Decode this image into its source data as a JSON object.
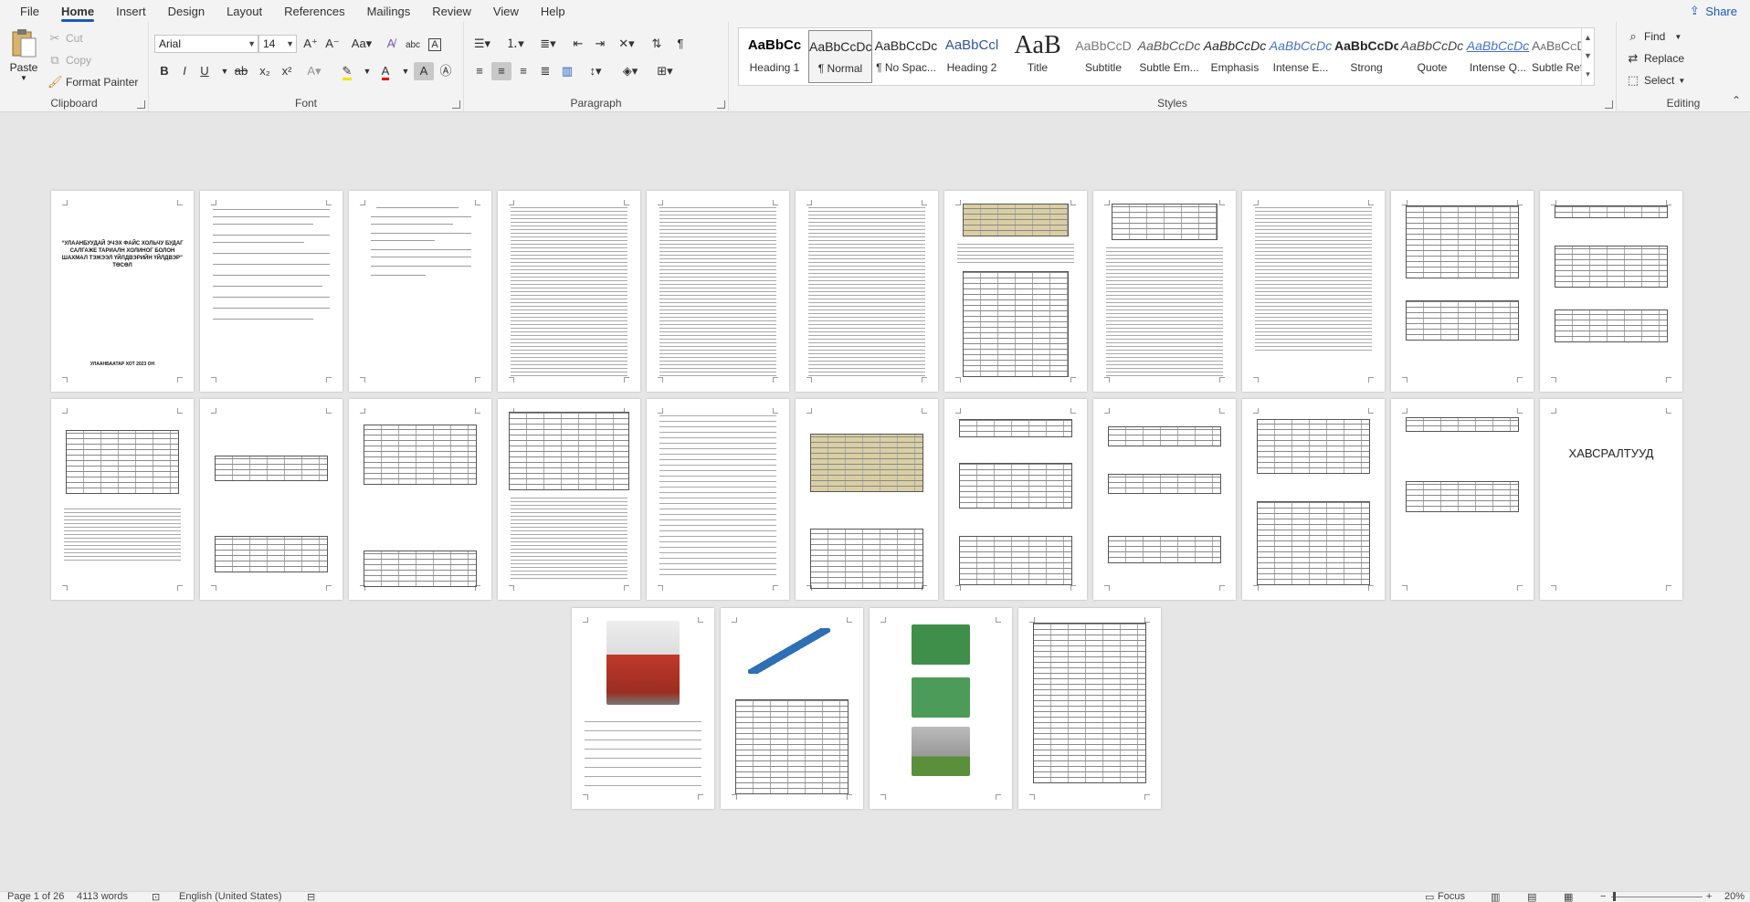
{
  "tabs": [
    "File",
    "Home",
    "Insert",
    "Design",
    "Layout",
    "References",
    "Mailings",
    "Review",
    "View",
    "Help"
  ],
  "active_tab": "Home",
  "share_label": "Share",
  "clipboard": {
    "paste": "Paste",
    "cut": "Cut",
    "copy": "Copy",
    "format_painter": "Format Painter",
    "label": "Clipboard"
  },
  "font": {
    "name": "Arial",
    "size": "14",
    "label": "Font"
  },
  "paragraph": {
    "label": "Paragraph"
  },
  "styles": {
    "label": "Styles",
    "items": [
      {
        "preview": "AaBbCc",
        "name": "Heading 1"
      },
      {
        "preview": "AaBbCcDc",
        "name": "¶ Normal"
      },
      {
        "preview": "AaBbCcDc",
        "name": "¶ No Spac..."
      },
      {
        "preview": "AaBbCcl",
        "name": "Heading 2"
      },
      {
        "preview": "AaB",
        "name": "Title"
      },
      {
        "preview": "AaBbCcD",
        "name": "Subtitle"
      },
      {
        "preview": "AaBbCcDc",
        "name": "Subtle Em..."
      },
      {
        "preview": "AaBbCcDc",
        "name": "Emphasis"
      },
      {
        "preview": "AaBbCcDc",
        "name": "Intense E..."
      },
      {
        "preview": "AaBbCcDc",
        "name": "Strong"
      },
      {
        "preview": "AaBbCcDc",
        "name": "Quote"
      },
      {
        "preview": "AaBbCcDc",
        "name": "Intense Q..."
      },
      {
        "preview": "AaBbCcDD",
        "name": "Subtle Ref..."
      }
    ]
  },
  "editing": {
    "find": "Find",
    "replace": "Replace",
    "select": "Select",
    "label": "Editing"
  },
  "document": {
    "cover_title": "“УЛААНБУУДАЙ ЭЧЭХ ФАЙС ХОЛЬЧУ БУДАГ САЛГАЖЕ ТАРИАЛН ХОЛИНОГ БОЛОН ШАХМАЛ ТЭЖЭЭЛ ҮЙЛДВЭРИЙН ҮЙЛДВЭР” ТӨСӨЛ",
    "cover_footer": "УЛААНБААТАР ХОТ 2023 ОН",
    "appendix_title": "ХАВСРАЛТУУД"
  },
  "status": {
    "page": "Page 1 of 26",
    "words": "4113 words",
    "language": "English (United States)",
    "focus": "Focus",
    "zoom": "20%"
  }
}
